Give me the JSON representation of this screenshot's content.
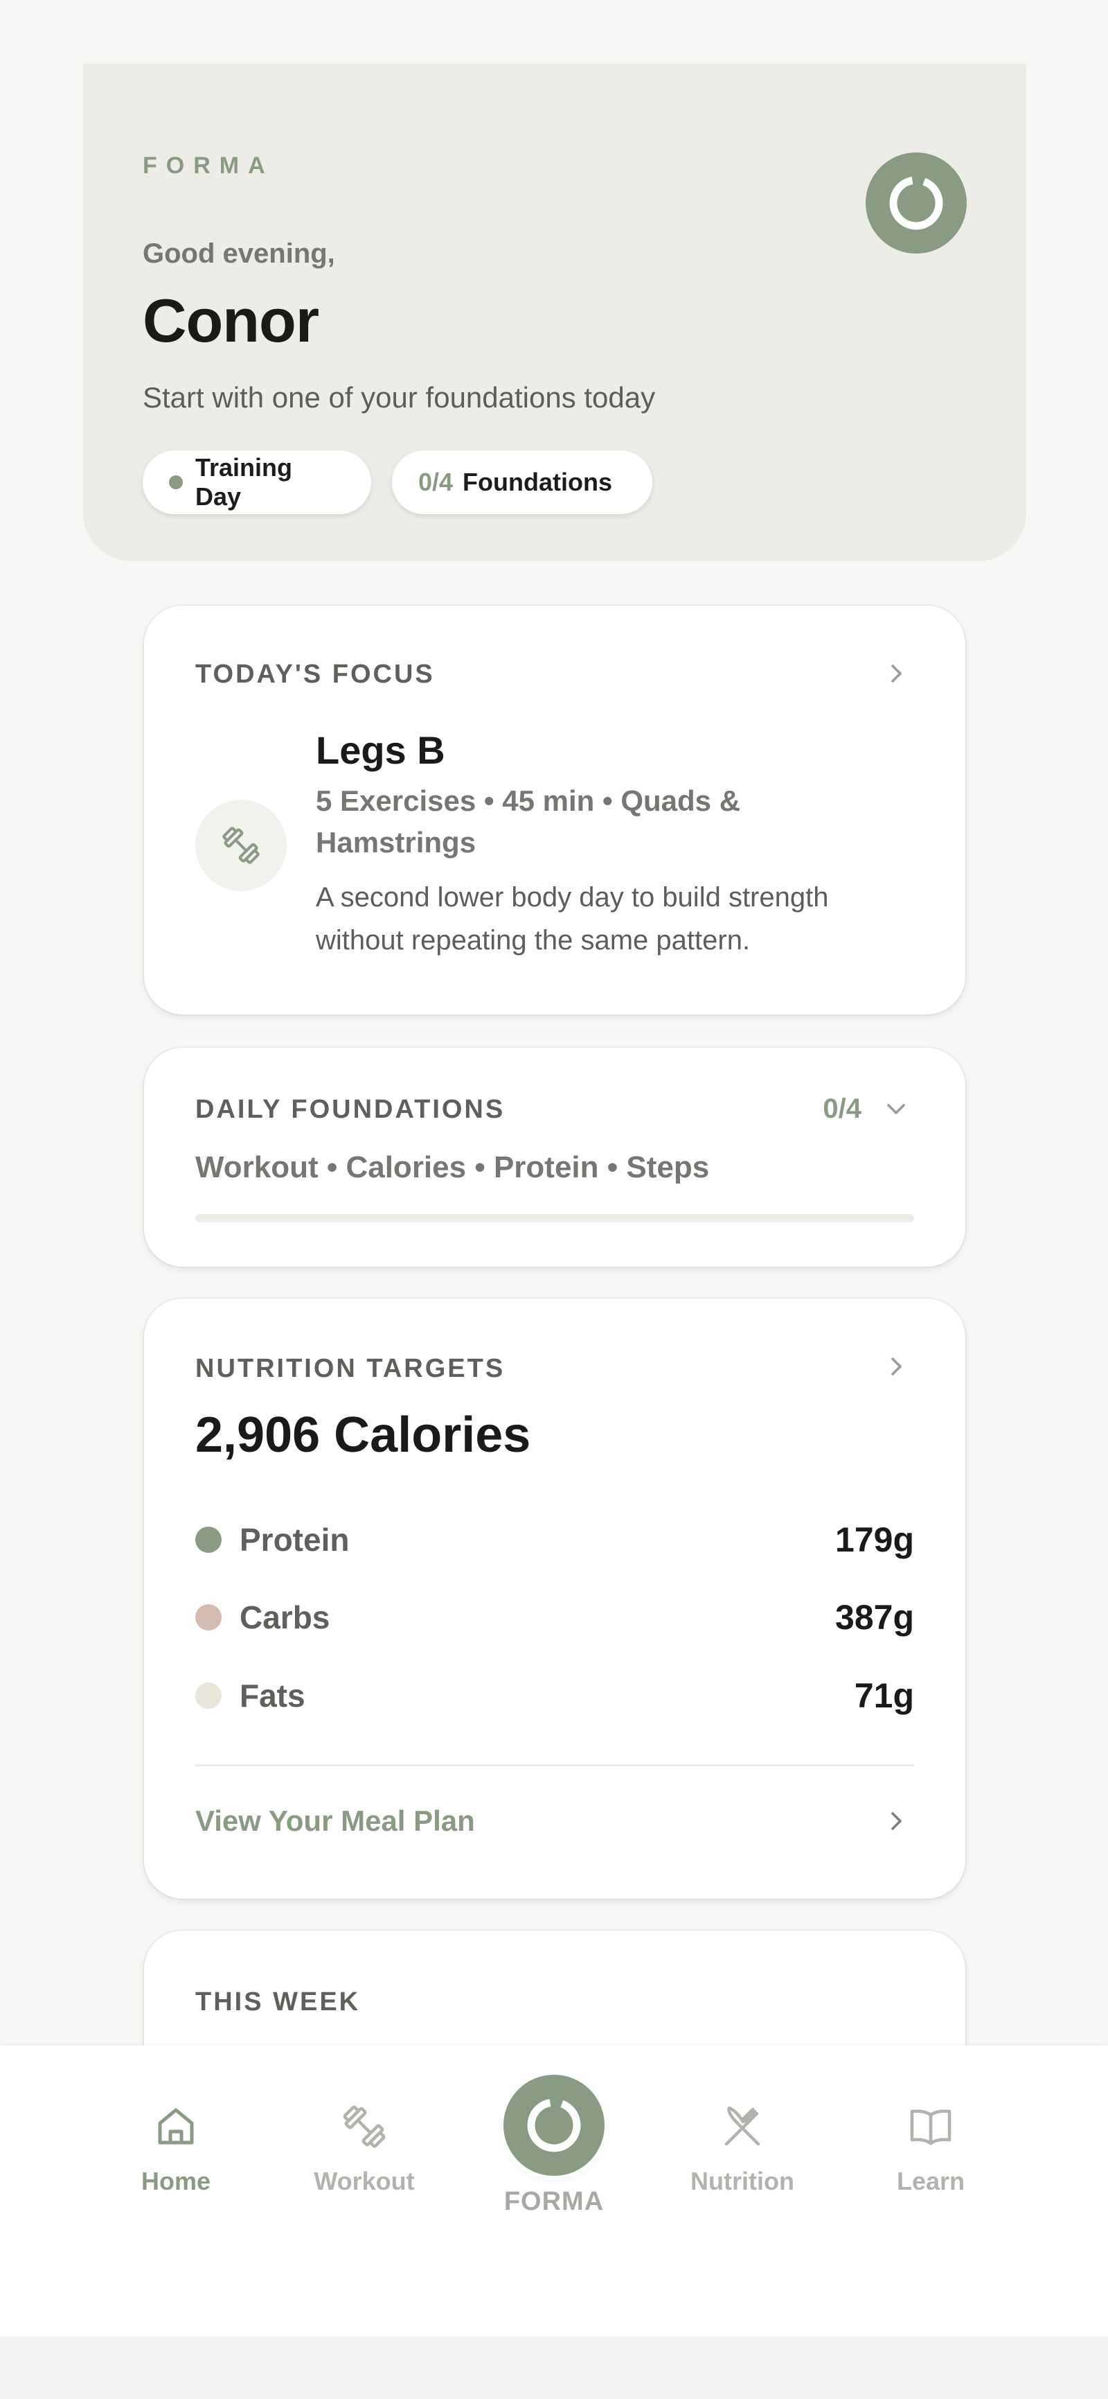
{
  "header": {
    "brand": "FORMA",
    "greeting": "Good evening,",
    "name": "Conor",
    "subtitle": "Start with one of your foundations today",
    "pills": {
      "training": "Training Day",
      "foundations_count": "0/4",
      "foundations_label": "Foundations"
    }
  },
  "focus": {
    "label": "TODAY'S FOCUS",
    "title": "Legs B",
    "meta": "5 Exercises • 45 min • Quads & Hamstrings",
    "description": "A second lower body day to build strength without repeating the same pattern."
  },
  "foundations": {
    "label": "DAILY FOUNDATIONS",
    "count": "0/4",
    "items": "Workout • Calories • Protein • Steps",
    "progress_fraction": 0
  },
  "nutrition": {
    "label": "NUTRITION TARGETS",
    "calories": "2,906 Calories",
    "macros": [
      {
        "name": "Protein",
        "value": "179g",
        "color": "#8a9b83"
      },
      {
        "name": "Carbs",
        "value": "387g",
        "color": "#d4bcb0"
      },
      {
        "name": "Fats",
        "value": "71g",
        "color": "#e9e6da"
      }
    ],
    "meal_plan_link": "View Your Meal Plan"
  },
  "week": {
    "label": "THIS WEEK"
  },
  "nav": {
    "home": "Home",
    "workout": "Workout",
    "center": "FORMA",
    "nutrition": "Nutrition",
    "learn": "Learn",
    "active": "home"
  },
  "colors": {
    "accent": "#8a9b83",
    "background": "#f8f7f5",
    "hero": "#edece8"
  }
}
